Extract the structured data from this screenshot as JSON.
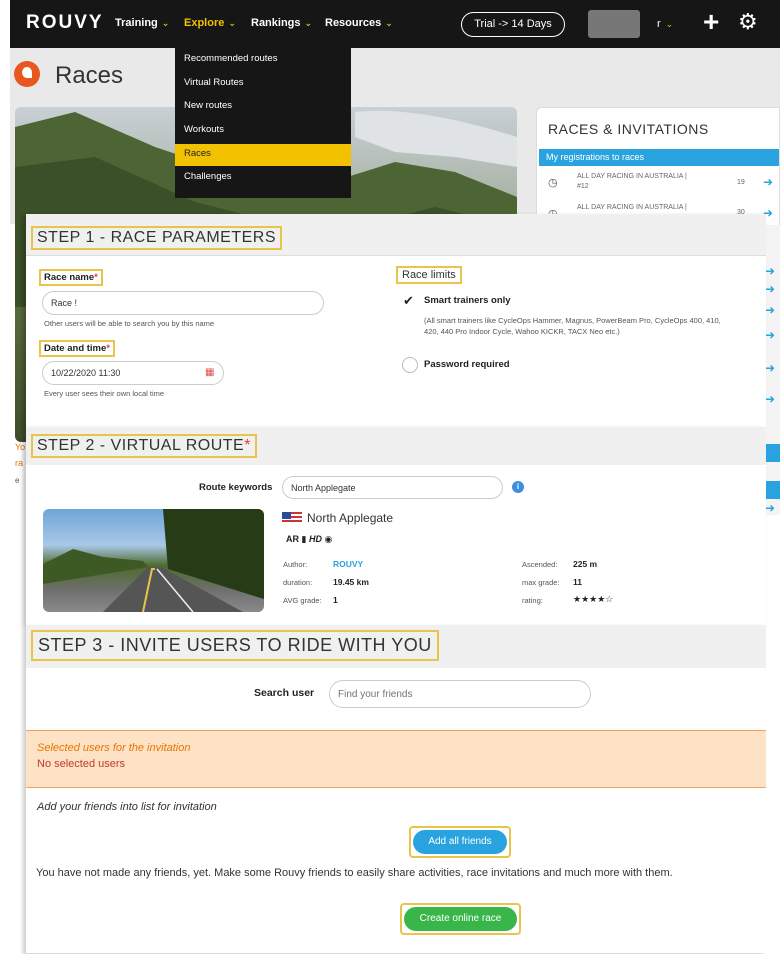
{
  "nav": {
    "logo": "ROUVY",
    "items": [
      {
        "label": "Training"
      },
      {
        "label": "Explore",
        "active": true
      },
      {
        "label": "Rankings"
      },
      {
        "label": "Resources"
      }
    ],
    "trial_label": "Trial -> 14 Days",
    "username_partial": "r",
    "icons": [
      "chevron-down-icon",
      "plus-icon",
      "gear-icon",
      "avatar"
    ]
  },
  "explore_menu": {
    "items": [
      {
        "label": "Recommended routes"
      },
      {
        "label": "Virtual Routes"
      },
      {
        "label": "New routes"
      },
      {
        "label": "Workouts"
      },
      {
        "label": "Races",
        "highlighted": true
      },
      {
        "label": "Challenges"
      }
    ]
  },
  "page": {
    "title": "Races",
    "left_fragments": [
      "Yo",
      "ra",
      "e"
    ]
  },
  "races_panel": {
    "title": "RACES & INVITATIONS",
    "tab": "My registrations to races",
    "rows": [
      {
        "name": "ALL DAY RACING IN AUSTRALIA |",
        "sub": "#12",
        "count": "19"
      },
      {
        "name": "ALL DAY RACING IN AUSTRALIA |",
        "sub": "",
        "count": "30"
      }
    ]
  },
  "step1": {
    "title": "STEP 1 - RACE PARAMETERS",
    "race_name_label": "Race name",
    "race_name_value": "Race !",
    "race_name_hint": "Other users will be able to search you by this name",
    "date_label": "Date and time",
    "date_value": "10/22/2020 11:30",
    "date_hint": "Every user sees their own local time",
    "limits_label": "Race limits",
    "smart_label": "Smart trainers only",
    "smart_hint": "(All smart trainers like CycleOps Hammer, Magnus, PowerBeam Pro, CycleOps 400, 410, 420, 440 Pro Indoor Cycle, Wahoo KICKR, TACX Neo etc.)",
    "smart_checked": true,
    "password_label": "Password required",
    "password_checked": false,
    "required_mark": "*"
  },
  "step2": {
    "title": "STEP 2 - VIRTUAL ROUTE",
    "keywords_label": "Route keywords",
    "keywords_value": "North Applegate",
    "route_name": "North Applegate",
    "badges": [
      "AR",
      "HD"
    ],
    "author_label": "Author:",
    "author_value": "ROUVY",
    "duration_label": "duration:",
    "duration_value": "19.45 km",
    "avg_label": "AVG grade:",
    "avg_value": "1",
    "ascended_label": "Ascended:",
    "ascended_value": "225 m",
    "maxgrade_label": "max grade:",
    "maxgrade_value": "11",
    "rating_label": "rating:",
    "rating_value": 4,
    "rating_max": 5
  },
  "step3": {
    "title": "STEP 3 - INVITE USERS TO RIDE WITH YOU",
    "search_label": "Search user",
    "search_placeholder": "Find your friends",
    "selected_title": "Selected users for the invitation",
    "selected_value": "No selected users",
    "add_hint": "Add your friends into list for invitation",
    "add_all_label": "Add all friends",
    "no_friends_text": "You have not made any friends, yet. Make some Rouvy friends to easily share activities, race invitations and much more with them.",
    "create_label": "Create online race"
  },
  "colors": {
    "accent_yellow": "#f2c200",
    "highlight_box": "#e8c54a",
    "blue": "#29a3e0",
    "green": "#38b64a",
    "selected_bg": "#fde2c6",
    "nav_bg": "#161616"
  }
}
